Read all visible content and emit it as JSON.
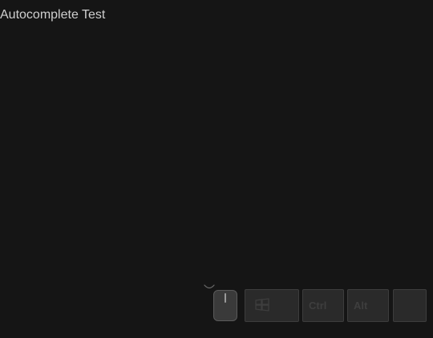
{
  "page": {
    "title": "Autocomplete Test"
  },
  "input_overlay": {
    "keys": {
      "ctrl_label": "Ctrl",
      "alt_label": "Alt"
    },
    "icons": {
      "loading": "loading-arc-icon",
      "mouse": "mouse-icon",
      "windows": "windows-icon"
    }
  },
  "colors": {
    "background": "#151515",
    "title_text": "#cfcfcf",
    "key_fill": "#2a2a2a",
    "key_border": "#3d3d3d",
    "key_text": "#3e3e3e"
  }
}
